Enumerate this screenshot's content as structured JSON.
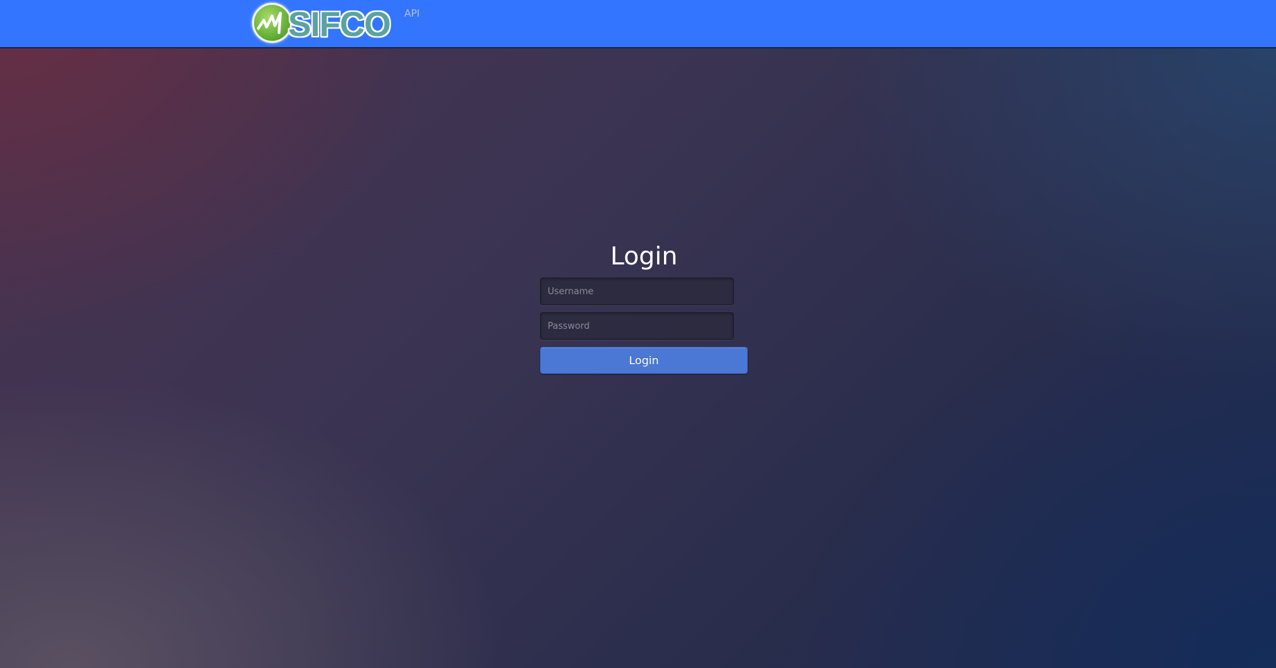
{
  "header": {
    "logo_text": "SIFCO",
    "nav": {
      "api_label": "API"
    }
  },
  "login": {
    "title": "Login",
    "username": {
      "placeholder": "Username",
      "value": ""
    },
    "password": {
      "placeholder": "Password",
      "value": ""
    },
    "submit_label": "Login"
  },
  "colors": {
    "header_background": "#3375fe",
    "button_background": "#4a78d4",
    "logo_green": "#6cb43c",
    "logo_text_teal": "#5aa3a0"
  }
}
